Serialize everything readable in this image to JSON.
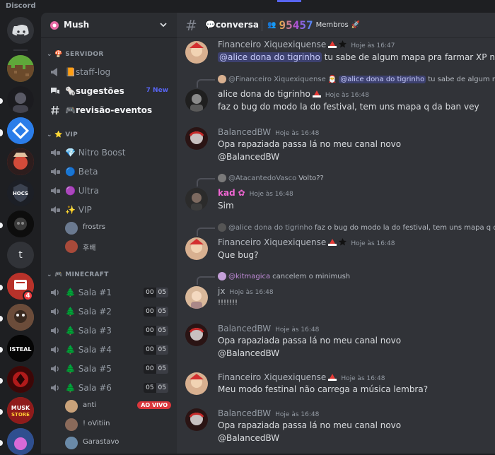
{
  "app": {
    "title": "Discord"
  },
  "server": {
    "name": "Mush",
    "initial": "t"
  },
  "rail": {
    "badges": [
      "4"
    ]
  },
  "categories": {
    "servidor": "SERVIDOR",
    "vip": "VIP",
    "minecraft": "MINECRAFT"
  },
  "channels": {
    "staff_log": "staff-log",
    "sugestoes": "sugestões",
    "sugestoes_new": "7 New",
    "revisao": "revisão-eventos",
    "nitro": "Nitro Boost",
    "beta": "Beta",
    "ultra": "Ultra",
    "vip": "VIP"
  },
  "vip_users": [
    "frostrs",
    "후배"
  ],
  "rooms": [
    {
      "name": "Sala #1",
      "count": "00",
      "limit": "05"
    },
    {
      "name": "Sala #2",
      "count": "00",
      "limit": "05"
    },
    {
      "name": "Sala #3",
      "count": "00",
      "limit": "05"
    },
    {
      "name": "Sala #4",
      "count": "00",
      "limit": "05"
    },
    {
      "name": "Sala #5",
      "count": "00",
      "limit": "05"
    },
    {
      "name": "Sala #6",
      "count": "05",
      "limit": "05"
    }
  ],
  "room_users": [
    "anti",
    "! oVitiin",
    "Garastavo"
  ],
  "live_label": "AO VIVO",
  "header": {
    "channel": "conversa",
    "member_count": "95457",
    "members_label": "Membros"
  },
  "messages": [
    {
      "author": "Financeiro Xiquexiquense",
      "time": "Hoje às 16:47",
      "mention": "@alice dona do tigrinho",
      "text": "tu sabe de algum mapa pra farmar XP no fortnite"
    },
    {
      "reply_name": "@Financeiro Xiquexiquense",
      "reply_mention": "@alice dona do tigrinho",
      "reply_text": "tu sabe de algum mapa pr",
      "author": "alice dona do tigrinho",
      "time": "Hoje às 16:48",
      "text": "faz o bug do modo la do festival, tem uns mapa q da ban vey"
    },
    {
      "author": "BalancedBW",
      "time": "Hoje às 16:48",
      "line1": "Opa rapaziada passa lá no meu canal novo",
      "line2": "@BalancedBW"
    },
    {
      "reply_name": "@AtacantedoVasco",
      "reply_text": "Volto??",
      "author": "kad",
      "time": "Hoje às 16:48",
      "text": "Sim"
    },
    {
      "reply_name": "@alice dona do tigrinho",
      "reply_text": "faz o bug do modo la do festival, tem uns mapa q da ban",
      "author": "Financeiro Xiquexiquense",
      "time": "Hoje às 16:48",
      "text": "Que bug?"
    },
    {
      "reply_name": "@kitmagica",
      "reply_text": "cancelem o minimush",
      "author": "jx",
      "time": "Hoje às 16:48",
      "text": "!!!!!!!"
    },
    {
      "author": "BalancedBW",
      "time": "Hoje às 16:48",
      "line1": "Opa rapaziada passa lá no meu canal novo",
      "line2": "@BalancedBW"
    },
    {
      "author": "Financeiro Xiquexiquense",
      "time": "Hoje às 16:48",
      "text": "Meu modo festinal não carrega a música lembra?"
    },
    {
      "author": "BalancedBW",
      "time": "Hoje às 16:48",
      "line1": "Opa rapaziada passa lá no meu canal novo",
      "line2": "@BalancedBW"
    }
  ]
}
